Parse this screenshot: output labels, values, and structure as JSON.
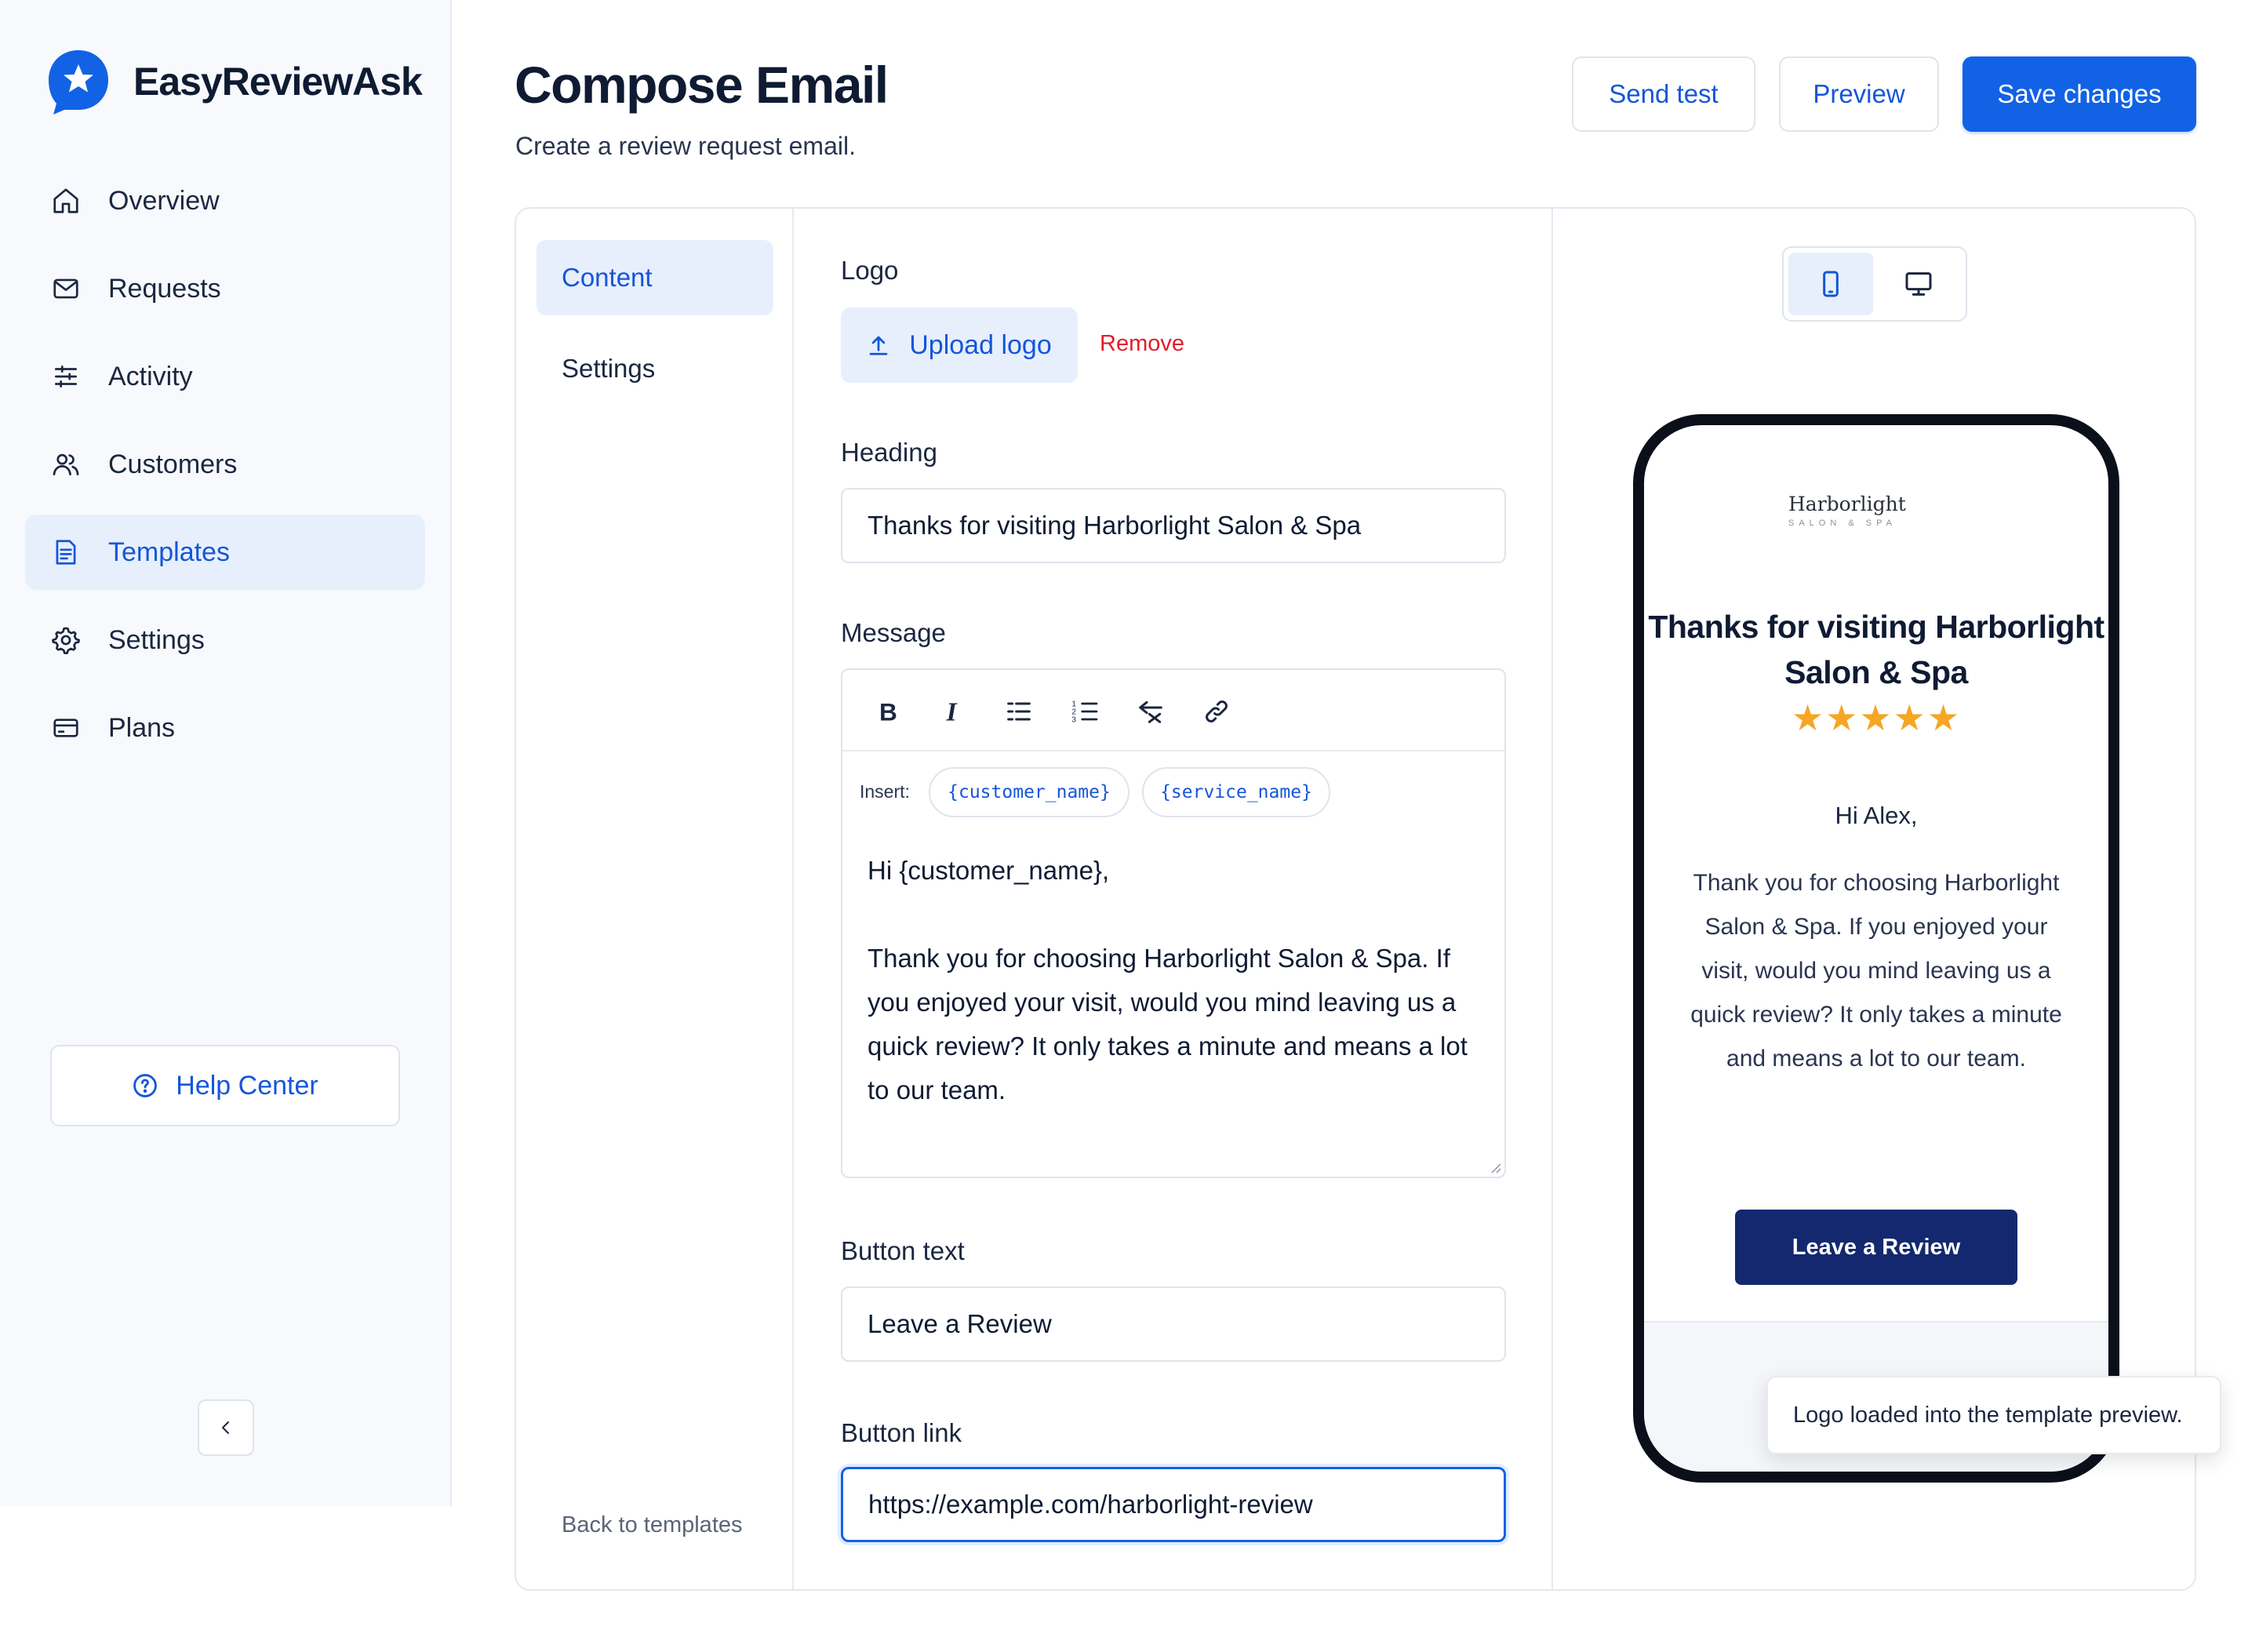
{
  "app": {
    "name": "EasyReviewAsk",
    "brand_color": "#1262e6"
  },
  "sidebar": {
    "items": [
      {
        "label": "Overview",
        "icon": "home-icon",
        "active": false
      },
      {
        "label": "Requests",
        "icon": "mail-icon",
        "active": false
      },
      {
        "label": "Activity",
        "icon": "sliders-icon",
        "active": false
      },
      {
        "label": "Customers",
        "icon": "users-icon",
        "active": false
      },
      {
        "label": "Templates",
        "icon": "document-icon",
        "active": true
      },
      {
        "label": "Settings",
        "icon": "gear-icon",
        "active": false
      },
      {
        "label": "Plans",
        "icon": "credit-card-icon",
        "active": false
      }
    ],
    "help_label": "Help Center",
    "collapse_icon": "chevron-left-icon"
  },
  "header": {
    "title": "Compose Email",
    "subtitle": "Create a review request email.",
    "send_test_label": "Send test",
    "preview_label": "Preview",
    "save_label": "Save changes"
  },
  "subnav": {
    "items": [
      {
        "label": "Content",
        "active": true
      },
      {
        "label": "Settings",
        "active": false
      }
    ],
    "back_label": "Back to templates"
  },
  "form": {
    "logo_label": "Logo",
    "upload_label": "Upload logo",
    "remove_label": "Remove",
    "heading_label": "Heading",
    "heading_value": "Thanks for visiting Harborlight Salon & Spa",
    "message_label": "Message",
    "toolbar": [
      "bold-icon",
      "italic-icon",
      "bulleted-list-icon",
      "numbered-list-icon",
      "clear-format-icon",
      "link-icon"
    ],
    "insert_label": "Insert:",
    "chips": [
      "{customer_name}",
      "{service_name}"
    ],
    "message_value": "Hi {customer_name},\n\nThank you for choosing Harborlight Salon & Spa. If you enjoyed your visit, would you mind leaving us a quick review? It only takes a minute and means a lot to our team.",
    "button_text_label": "Button text",
    "button_text_value": "Leave a Review",
    "button_link_label": "Button link",
    "button_link_value": "https://example.com/harborlight-review"
  },
  "preview": {
    "device_mode": "mobile",
    "logo_name": "Harborlight",
    "logo_tagline": "SALON & SPA",
    "heading": "Thanks for visiting Harborlight Salon & Spa",
    "stars": "★★★★★",
    "rating": 5,
    "greeting": "Hi Alex,",
    "body": "Thank you for choosing Harborlight Salon & Spa. If you enjoyed your visit, would you mind leaving us a quick review? It only takes a minute and means a lot to our team.",
    "cta": "Leave a Review",
    "cta_color": "#13286e",
    "star_color": "#f5a623"
  },
  "toast": {
    "message": "Logo loaded into the template preview."
  }
}
